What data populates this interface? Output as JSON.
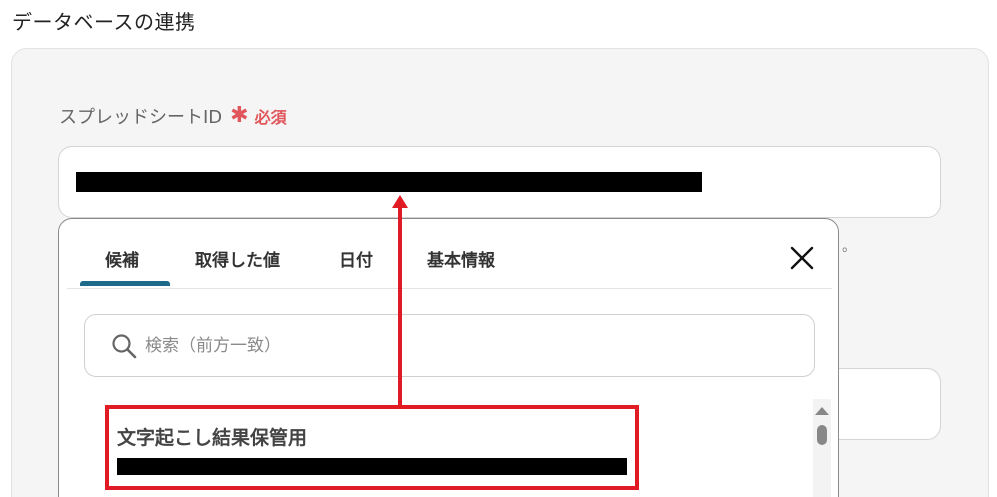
{
  "section": {
    "title": "データベースの連携"
  },
  "field": {
    "label": "スプレッドシートID",
    "required_mark": "✱",
    "required_text": "必須",
    "value_redacted": true
  },
  "trailing_text": "。",
  "popup": {
    "tabs": [
      {
        "label": "候補",
        "active": true
      },
      {
        "label": "取得した値",
        "active": false
      },
      {
        "label": "日付",
        "active": false
      },
      {
        "label": "基本情報",
        "active": false
      }
    ],
    "close_icon": "close-icon",
    "search": {
      "placeholder": "検索（前方一致）",
      "value": "",
      "icon": "search-icon"
    },
    "items": [
      {
        "title": "文字起こし結果保管用",
        "subtitle_redacted": true
      }
    ]
  },
  "annotation": {
    "color": "#e01b24"
  },
  "colors": {
    "accent": "#1e6a8a",
    "required": "#e0565b"
  }
}
